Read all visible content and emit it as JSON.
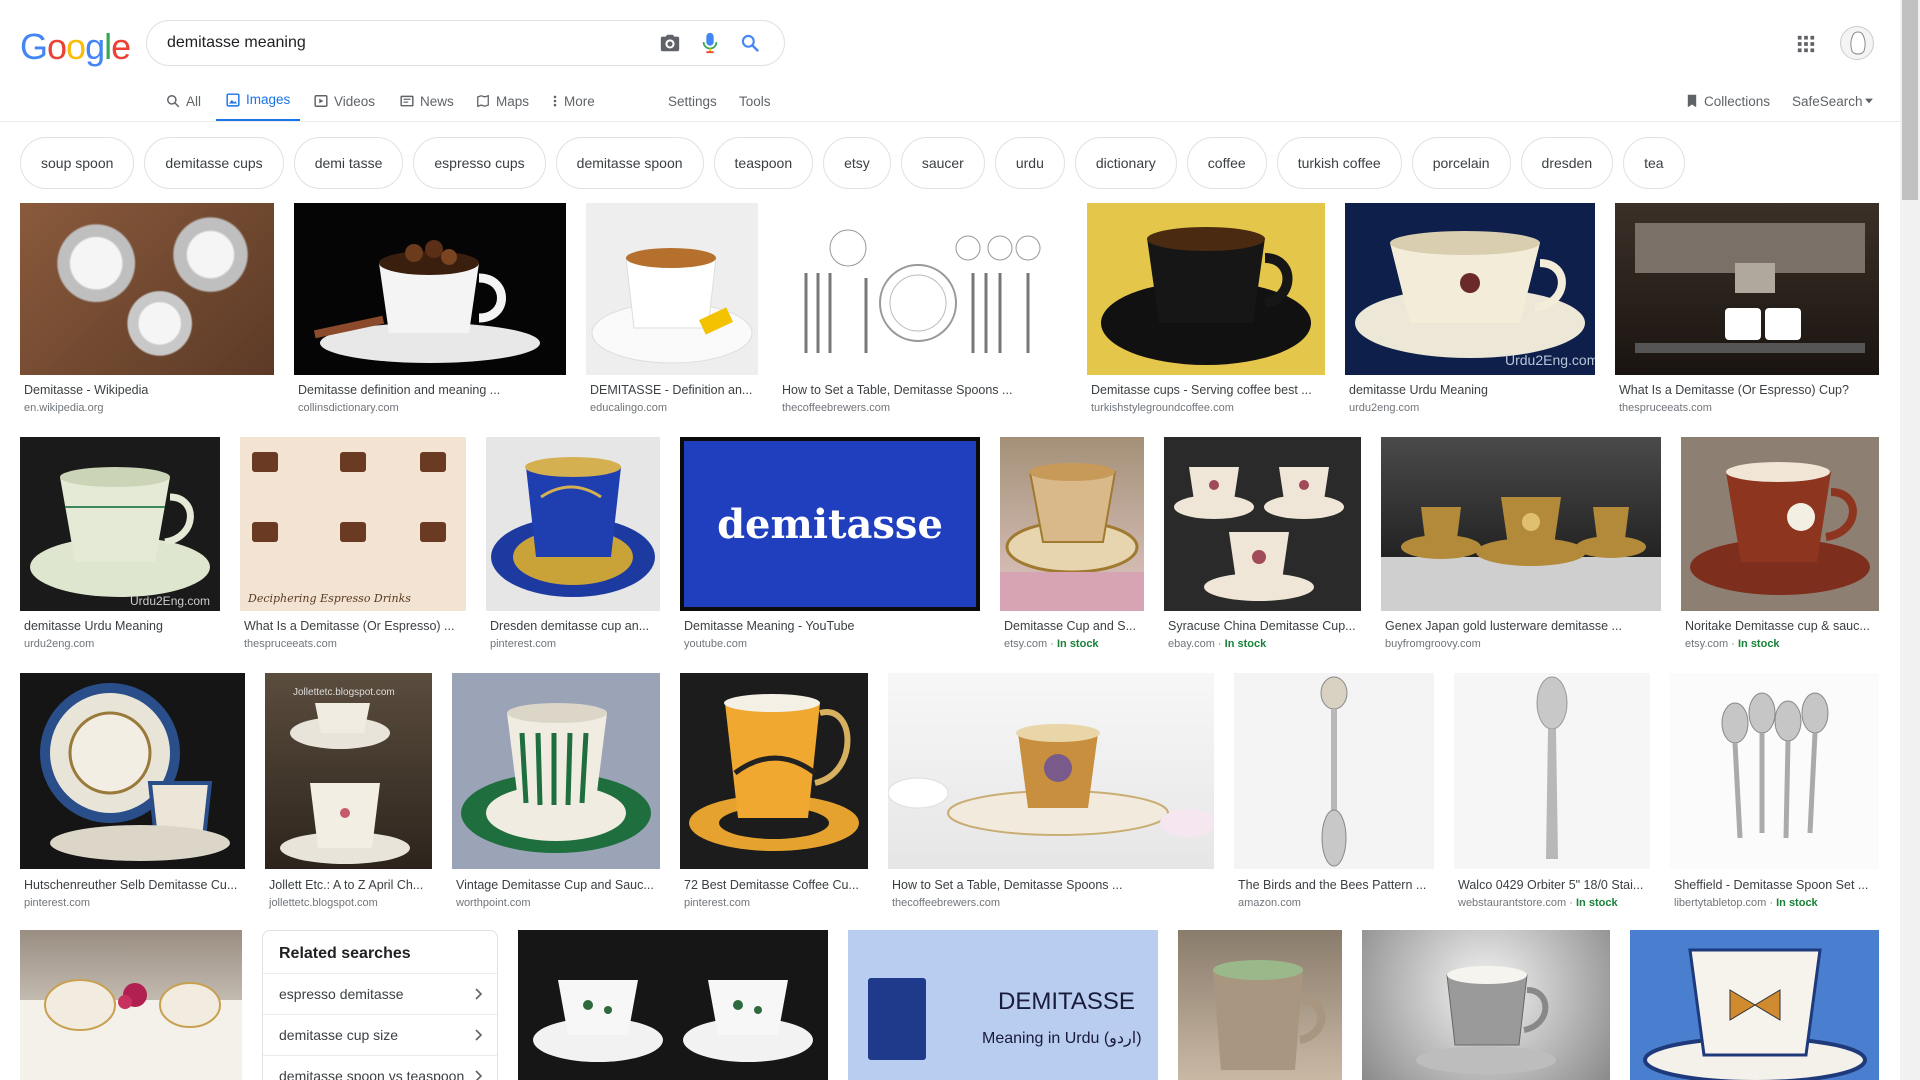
{
  "logo": "Google",
  "search": {
    "query": "demitasse meaning"
  },
  "tabs": [
    {
      "label": "All"
    },
    {
      "label": "Images"
    },
    {
      "label": "Videos"
    },
    {
      "label": "News"
    },
    {
      "label": "Maps"
    },
    {
      "label": "More"
    },
    {
      "label": "Settings"
    },
    {
      "label": "Tools"
    }
  ],
  "right_links": {
    "collections": "Collections",
    "safesearch": "SafeSearch"
  },
  "chips": [
    "soup spoon",
    "demitasse cups",
    "demi tasse",
    "espresso cups",
    "demitasse spoon",
    "teaspoon",
    "etsy",
    "saucer",
    "urdu",
    "dictionary",
    "coffee",
    "turkish coffee",
    "porcelain",
    "dresden",
    "tea"
  ],
  "results": [
    {
      "caption": "Demitasse - Wikipedia",
      "source": "en.wikipedia.org",
      "stock": ""
    },
    {
      "caption": "Demitasse definition and meaning ...",
      "source": "collinsdictionary.com",
      "stock": ""
    },
    {
      "caption": "DEMITASSE - Definition an...",
      "source": "educalingo.com",
      "stock": ""
    },
    {
      "caption": "How to Set a Table, Demitasse Spoons ...",
      "source": "thecoffeebrewers.com",
      "stock": ""
    },
    {
      "caption": "Demitasse cups - Serving coffee best ...",
      "source": "turkishstylegroundcoffee.com",
      "stock": ""
    },
    {
      "caption": "demitasse Urdu Meaning",
      "source": "urdu2eng.com",
      "stock": ""
    },
    {
      "caption": "What Is a Demitasse (Or Espresso) Cup?",
      "source": "thespruceeats.com",
      "stock": ""
    },
    {
      "caption": "demitasse Urdu Meaning",
      "source": "urdu2eng.com",
      "stock": ""
    },
    {
      "caption": "What Is a Demitasse (Or Espresso) ...",
      "source": "thespruceeats.com",
      "stock": ""
    },
    {
      "caption": "Dresden demitasse cup an...",
      "source": "pinterest.com",
      "stock": ""
    },
    {
      "caption": "Demitasse Meaning - YouTube",
      "source": "youtube.com",
      "stock": ""
    },
    {
      "caption": "Demitasse Cup and S...",
      "source": "etsy.com",
      "stock": "In stock"
    },
    {
      "caption": "Syracuse China Demitasse Cup...",
      "source": "ebay.com",
      "stock": "In stock"
    },
    {
      "caption": "Genex Japan gold lusterware demitasse ...",
      "source": "buyfromgroovy.com",
      "stock": ""
    },
    {
      "caption": "Noritake Demitasse cup & sauc...",
      "source": "etsy.com",
      "stock": "In stock"
    },
    {
      "caption": "Hutschenreuther Selb Demitasse Cu...",
      "source": "pinterest.com",
      "stock": ""
    },
    {
      "caption": "Jollett Etc.: A to Z April Ch...",
      "source": "jollettetc.blogspot.com",
      "stock": ""
    },
    {
      "caption": "Vintage Demitasse Cup and Sauc...",
      "source": "worthpoint.com",
      "stock": ""
    },
    {
      "caption": "72 Best Demitasse Coffee Cu...",
      "source": "pinterest.com",
      "stock": ""
    },
    {
      "caption": "How to Set a Table, Demitasse Spoons ...",
      "source": "thecoffeebrewers.com",
      "stock": ""
    },
    {
      "caption": "The Birds and the Bees Pattern ...",
      "source": "amazon.com",
      "stock": ""
    },
    {
      "caption": "Walco 0429 Orbiter 5\" 18/0 Stai...",
      "source": "webstaurantstore.com",
      "stock": "In stock"
    },
    {
      "caption": "Sheffield - Demitasse Spoon Set ...",
      "source": "libertytabletop.com",
      "stock": "In stock"
    }
  ],
  "image_text": {
    "demitasse_banner": "demitasse",
    "urdu_title": "DEMITASSE",
    "urdu_sub": "Meaning in Urdu (اردو)",
    "watermark": "Urdu2Eng.com",
    "espresso_caption": "Deciphering Espresso Drinks"
  },
  "related": {
    "title": "Related searches",
    "items": [
      "espresso demitasse",
      "demitasse cup size",
      "demitasse spoon vs teaspoon"
    ]
  },
  "colors": {
    "accent": "#1a73e8",
    "stock": "#188038"
  }
}
